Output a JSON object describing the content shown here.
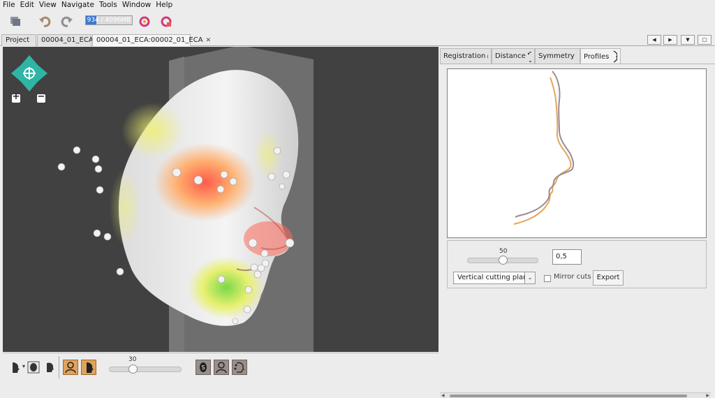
{
  "menu": [
    "File",
    "Edit",
    "View",
    "Navigate",
    "Tools",
    "Window",
    "Help"
  ],
  "toolbar": {
    "memory_label": "934 / 4096MB",
    "memory_fraction": 0.23
  },
  "doc_tabs": [
    {
      "label": "Project",
      "closable": false,
      "active": false
    },
    {
      "label": "00004_01_ECA",
      "closable": true,
      "active": false
    },
    {
      "label": "00004_01_ECA:00002_01_ECA",
      "closable": true,
      "active": true
    }
  ],
  "doc_nav": {
    "prev": "◀",
    "next": "▶",
    "list": "▼",
    "restore": "□"
  },
  "viewport": {
    "zoom_in": "+",
    "zoom_out": "−",
    "colors": {
      "background": "#414141",
      "plane": "#6e6e6e",
      "landmark": "#f2f2f2"
    }
  },
  "bottom": {
    "slider_value": "30",
    "slider_fraction": 0.3
  },
  "panel_tabs": [
    {
      "label": "Registration",
      "active": false
    },
    {
      "label": "Distance",
      "active": false
    },
    {
      "label": "Symmetry",
      "active": false
    },
    {
      "label": "Profiles",
      "active": true
    }
  ],
  "profiles": {
    "colors": {
      "primary": "#9a8a94",
      "secondary": "#e3a65a"
    },
    "slider_value": "50",
    "slider_fraction": 0.5,
    "input_value": "0,5",
    "plane_select": "Vertical cutting plane",
    "mirror_label": "Mirror cuts",
    "mirror_checked": false,
    "export_label": "Export"
  }
}
